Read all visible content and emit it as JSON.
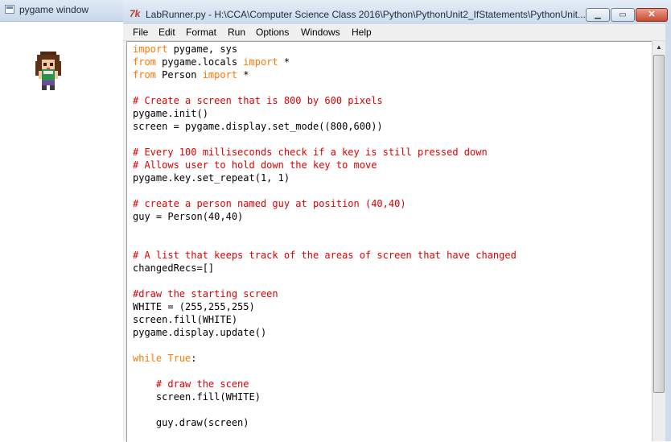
{
  "pygame_window": {
    "title": "pygame window"
  },
  "editor_window": {
    "title": "LabRunner.py - H:\\CCA\\Computer Science Class 2016\\Python\\PythonUnit2_IfStatements\\PythonUnit...",
    "icon": "tk-feather-icon",
    "controls": {
      "minimize": "minimize-icon",
      "maximize": "maximize-icon",
      "close": "close-icon"
    },
    "menu": [
      "File",
      "Edit",
      "Format",
      "Run",
      "Options",
      "Windows",
      "Help"
    ],
    "colors": {
      "keyword": "#ff7700",
      "comment": "#dd0000",
      "text": "#000000"
    },
    "code_lines": [
      [
        {
          "t": "import",
          "c": "kw"
        },
        {
          "t": " pygame, sys",
          "c": "plain"
        }
      ],
      [
        {
          "t": "from",
          "c": "kw"
        },
        {
          "t": " pygame.locals ",
          "c": "plain"
        },
        {
          "t": "import",
          "c": "kw"
        },
        {
          "t": " *",
          "c": "plain"
        }
      ],
      [
        {
          "t": "from",
          "c": "kw"
        },
        {
          "t": " Person ",
          "c": "plain"
        },
        {
          "t": "import",
          "c": "kw"
        },
        {
          "t": " *",
          "c": "plain"
        }
      ],
      [],
      [
        {
          "t": "# Create a screen that is 800 by 600 pixels",
          "c": "cm"
        }
      ],
      [
        {
          "t": "pygame.init()",
          "c": "plain"
        }
      ],
      [
        {
          "t": "screen = pygame.display.set_mode((800,600))",
          "c": "plain"
        }
      ],
      [],
      [
        {
          "t": "# Every 100 milliseconds check if a key is still pressed down",
          "c": "cm"
        }
      ],
      [
        {
          "t": "# Allows user to hold down the key to move",
          "c": "cm"
        }
      ],
      [
        {
          "t": "pygame.key.set_repeat(1, 1)",
          "c": "plain"
        }
      ],
      [],
      [
        {
          "t": "# create a person named guy at position (40,40)",
          "c": "cm"
        }
      ],
      [
        {
          "t": "guy = Person(40,40)",
          "c": "plain"
        }
      ],
      [],
      [],
      [
        {
          "t": "# A list that keeps track of the areas of screen that have changed",
          "c": "cm"
        }
      ],
      [
        {
          "t": "changedRecs=[]",
          "c": "plain"
        }
      ],
      [],
      [
        {
          "t": "#draw the starting screen",
          "c": "cm"
        }
      ],
      [
        {
          "t": "WHITE = (255,255,255)",
          "c": "plain"
        }
      ],
      [
        {
          "t": "screen.fill(WHITE)",
          "c": "plain"
        }
      ],
      [
        {
          "t": "pygame.display.update()",
          "c": "plain"
        }
      ],
      [],
      [
        {
          "t": "while",
          "c": "kw"
        },
        {
          "t": " ",
          "c": "plain"
        },
        {
          "t": "True",
          "c": "kw"
        },
        {
          "t": ":",
          "c": "plain"
        }
      ],
      [],
      [
        {
          "t": "    ",
          "c": "plain"
        },
        {
          "t": "# draw the scene",
          "c": "cm"
        }
      ],
      [
        {
          "t": "    screen.fill(WHITE)",
          "c": "plain"
        }
      ],
      [],
      [
        {
          "t": "    guy.draw(screen)",
          "c": "plain"
        }
      ]
    ]
  }
}
